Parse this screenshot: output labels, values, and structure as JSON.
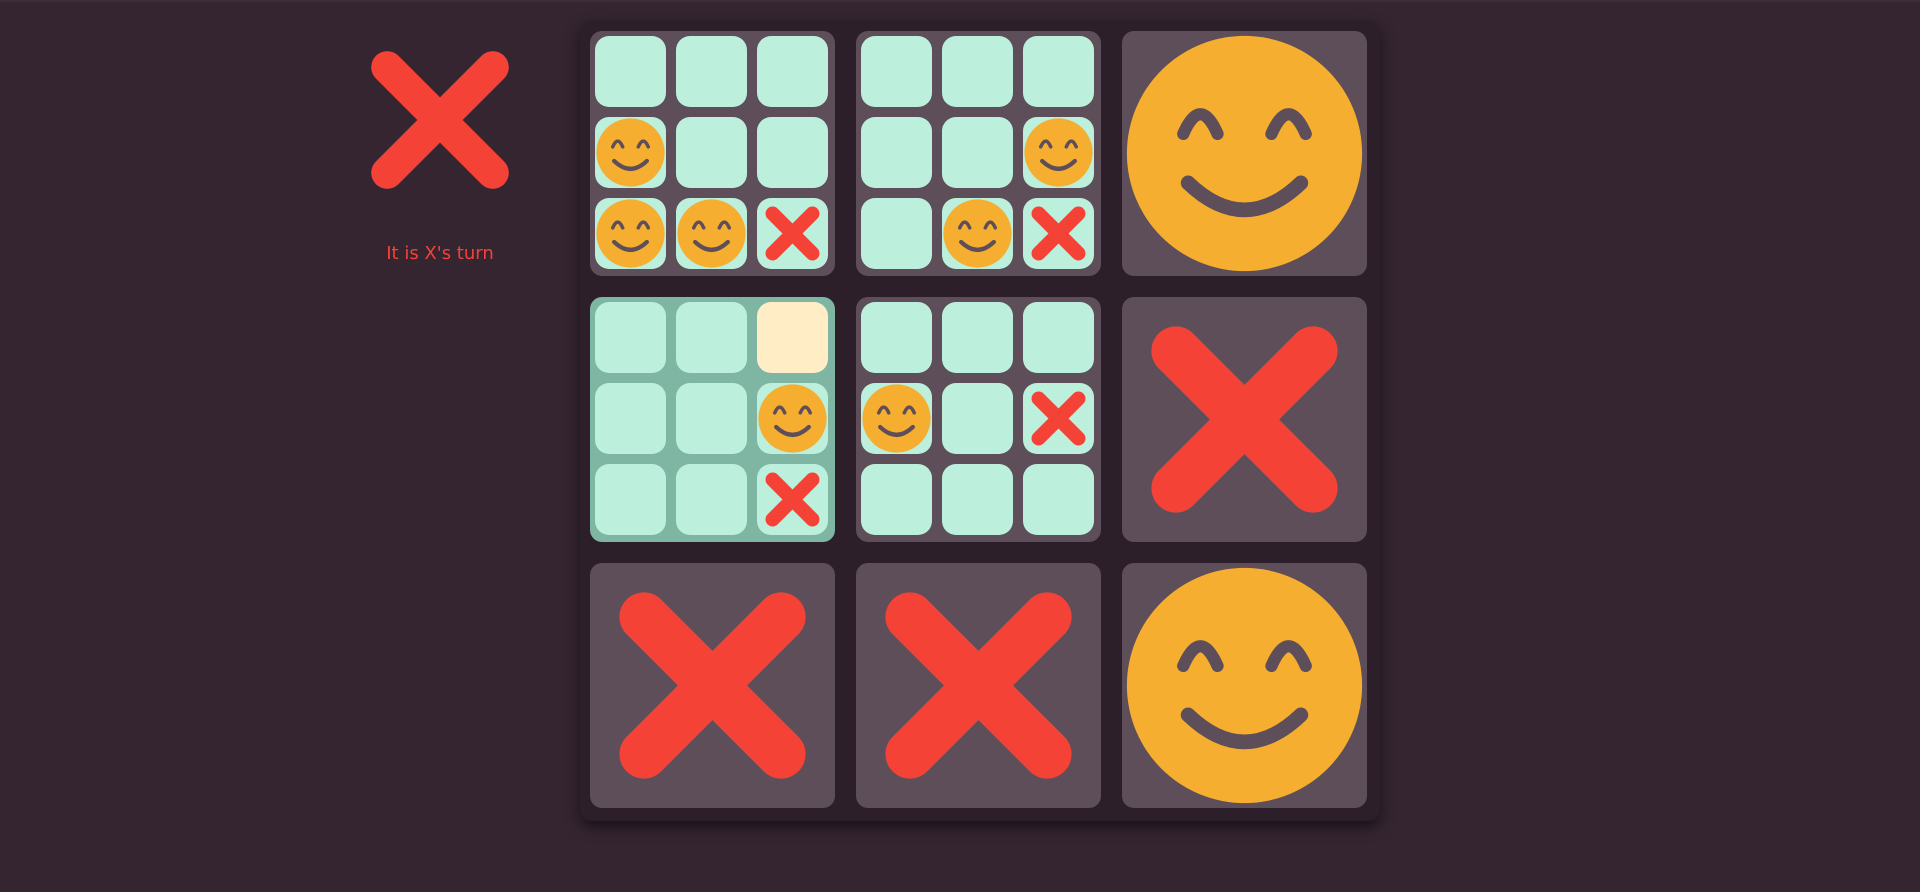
{
  "status": {
    "current_player": "X",
    "turn_text": "It is X's turn",
    "turn_icon": "x-mark-icon"
  },
  "colors": {
    "background": "#342531",
    "board": "#2c1f29",
    "sub_board": "#5d4e59",
    "active_sub_board": "#7eb5a3",
    "cell": "#bcefdc",
    "hover_cell": "#ffedc6",
    "x": "#f44336",
    "o": "#f5ae30",
    "o_features": "#5d4e59"
  },
  "board": {
    "active_sub_board": 3,
    "hover_cell": {
      "sub_board": 3,
      "cell": 2
    },
    "sub_boards": [
      {
        "winner": "",
        "cells": [
          "",
          "",
          "",
          "O",
          "",
          "",
          "O",
          "O",
          "X"
        ]
      },
      {
        "winner": "",
        "cells": [
          "",
          "",
          "",
          "",
          "",
          "O",
          "",
          "O",
          "X"
        ]
      },
      {
        "winner": "O",
        "cells": []
      },
      {
        "winner": "",
        "cells": [
          "",
          "",
          "",
          "",
          "",
          "O",
          "",
          "",
          "X"
        ]
      },
      {
        "winner": "",
        "cells": [
          "",
          "",
          "",
          "O",
          "",
          "X",
          "",
          "",
          ""
        ]
      },
      {
        "winner": "X",
        "cells": []
      },
      {
        "winner": "X",
        "cells": []
      },
      {
        "winner": "X",
        "cells": []
      },
      {
        "winner": "O",
        "cells": []
      }
    ]
  }
}
